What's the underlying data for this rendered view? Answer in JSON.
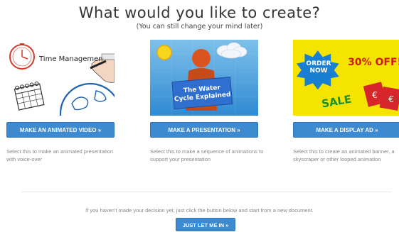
{
  "header": {
    "title": "What would you like to create?",
    "subtitle": "(You can still change your mind later)"
  },
  "cards": [
    {
      "thumbnail_text": "Time Managemen",
      "button_label": "MAKE AN ANIMATED VIDEO »",
      "description": "Select this to make an animated presentation with voice-over"
    },
    {
      "thumbnail_text": "The Water Cycle Explained",
      "button_label": "MAKE A PRESENTATION »",
      "description": "Select this to make a sequence of animations to support your presentation"
    },
    {
      "thumbnail_text_1": "ORDER NOW",
      "thumbnail_text_2": "30% OFF!",
      "thumbnail_text_3": "SALE",
      "button_label": "MAKE A DISPLAY AD »",
      "description": "Select this to create an animated banner, a skyscraper or other looped animation"
    }
  ],
  "footer": {
    "note": "If you haven't made your decision yet, just click the button below and start from a new document.",
    "button_label": "JUST LET ME IN »"
  },
  "colors": {
    "button": "#3d8ad0",
    "ad_background": "#f5e400",
    "ad_badge": "#1a7fd0",
    "presentation_sky": "#4aa0dc"
  }
}
